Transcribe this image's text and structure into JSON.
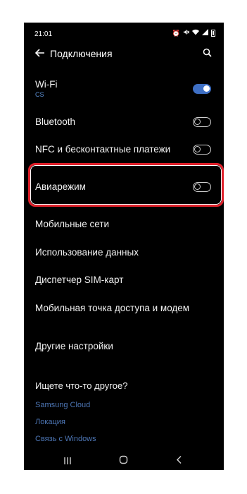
{
  "status_bar": {
    "time": "21:01",
    "icons": [
      "alarm-icon",
      "mute-icon",
      "wifi-icon",
      "signal-icon",
      "battery-icon"
    ]
  },
  "header": {
    "title": "Подключения"
  },
  "settings": [
    {
      "label": "Wi-Fi",
      "subtitle": "CS",
      "toggle": true,
      "state": "on"
    },
    {
      "label": "Bluetooth",
      "toggle": true,
      "state": "off"
    },
    {
      "label": "NFC и бесконтактные платежи",
      "toggle": true,
      "state": "off"
    },
    {
      "label": "Авиарежим",
      "toggle": true,
      "state": "off",
      "highlighted": true
    },
    {
      "label": "Мобильные сети"
    },
    {
      "label": "Использование данных"
    },
    {
      "label": "Диспетчер SIM-карт"
    },
    {
      "label": "Мобильная точка доступа и модем"
    },
    {
      "label": "Другие настройки"
    }
  ],
  "suggestions": {
    "title": "Ищете что-то другое?",
    "links": [
      "Samsung Cloud",
      "Локация",
      "Связь с Windows"
    ]
  },
  "colors": {
    "background": "#000000",
    "accent": "#3e6fc4",
    "highlight": "#e0202a",
    "link": "#4d76b5"
  }
}
